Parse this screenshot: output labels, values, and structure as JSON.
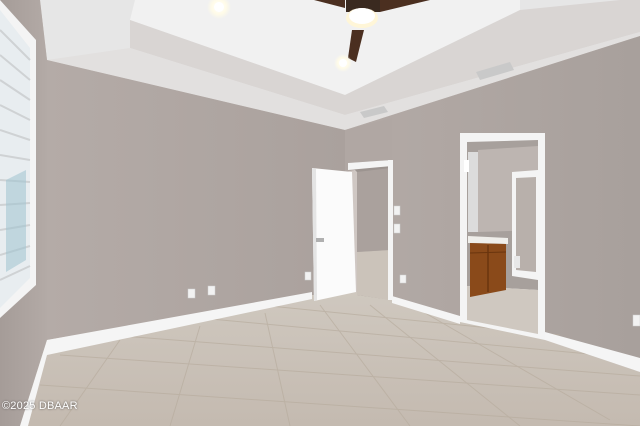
{
  "watermark": "©2025 DBAAR",
  "scene": {
    "type": "empty bedroom interior photo",
    "colors": {
      "wall": "#b3aaa6",
      "ceiling": "#ececec",
      "trim": "#f7f7f7",
      "floor": "#c9c1b8",
      "cabinet": "#8a4a1a"
    }
  }
}
